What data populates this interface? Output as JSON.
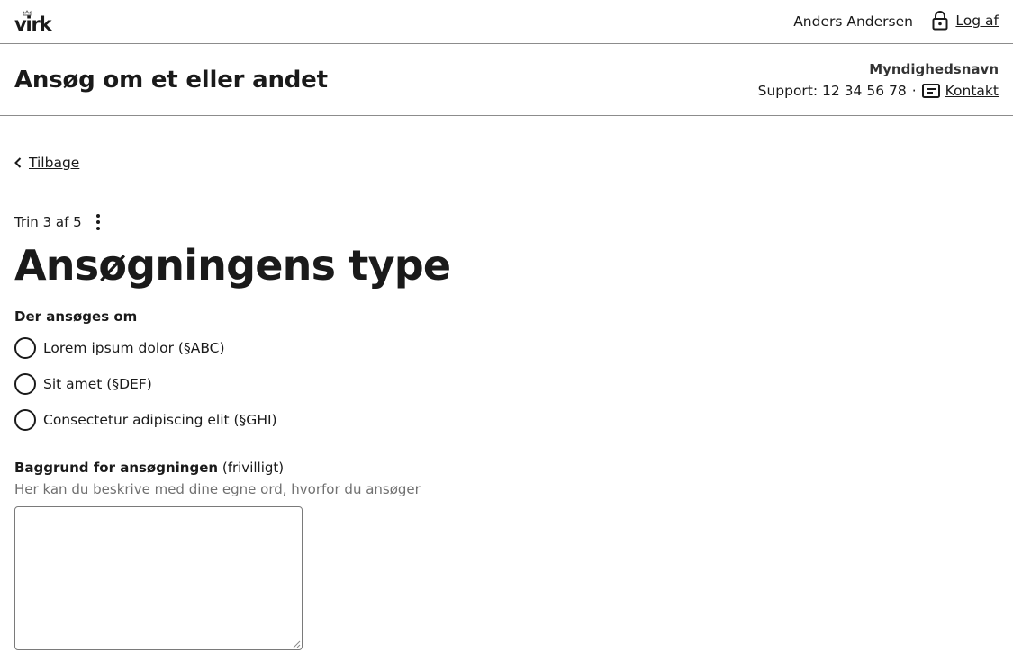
{
  "topbar": {
    "logo_text": "virk",
    "user_name": "Anders Andersen",
    "logout_label": "Log af"
  },
  "header": {
    "app_title": "Ansøg om et eller andet",
    "authority": "Myndighedsnavn",
    "support_text": "Support: 12 34 56 78",
    "separator": "·",
    "contact_label": "Kontakt"
  },
  "nav": {
    "back_label": "Tilbage"
  },
  "step": {
    "label": "Trin 3 af 5"
  },
  "page": {
    "title": "Ansøgningens type"
  },
  "application_type": {
    "legend": "Der ansøges om",
    "options": [
      {
        "label": "Lorem ipsum dolor (§ABC)",
        "checked": false
      },
      {
        "label": "Sit amet (§DEF)",
        "checked": false
      },
      {
        "label": "Consectetur adipiscing elit (§GHI)",
        "checked": false
      }
    ]
  },
  "background_field": {
    "label": "Baggrund for ansøgningen",
    "optional": "(frivilligt)",
    "hint": "Her kan du beskrive med dine egne ord, hvorfor du ansøger",
    "value": ""
  },
  "icons": {
    "logo_crown": "crown-icon",
    "logout": "lock-icon",
    "contact": "message-icon",
    "back": "chevron-left-icon",
    "step_menu": "kebab-menu-icon"
  }
}
